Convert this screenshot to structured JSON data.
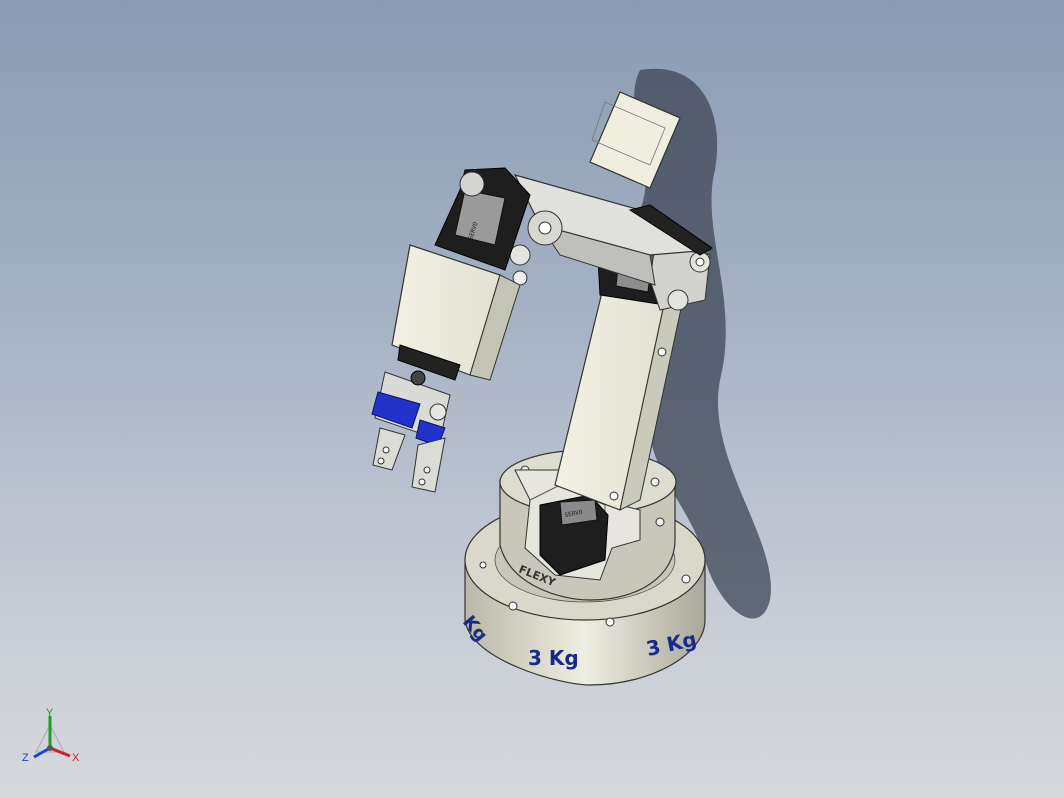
{
  "scene": {
    "base_weight_labels": [
      "3 Kg",
      "3 Kg",
      "Kg"
    ],
    "brand_label": "FLEXY",
    "colors": {
      "background_top": "#8a9bb4",
      "background_bottom": "#d6d8dc",
      "part_light": "#e9e8d8",
      "part_gray": "#cfd0cc",
      "servo_dark": "#222222",
      "gripper_accent": "#2233cc",
      "label_blue": "#1a2a8a"
    }
  },
  "triad": {
    "x_label": "X",
    "y_label": "Y",
    "z_label": "Z",
    "x_color": "#d42020",
    "y_color": "#20a020",
    "z_color": "#2040d0"
  }
}
